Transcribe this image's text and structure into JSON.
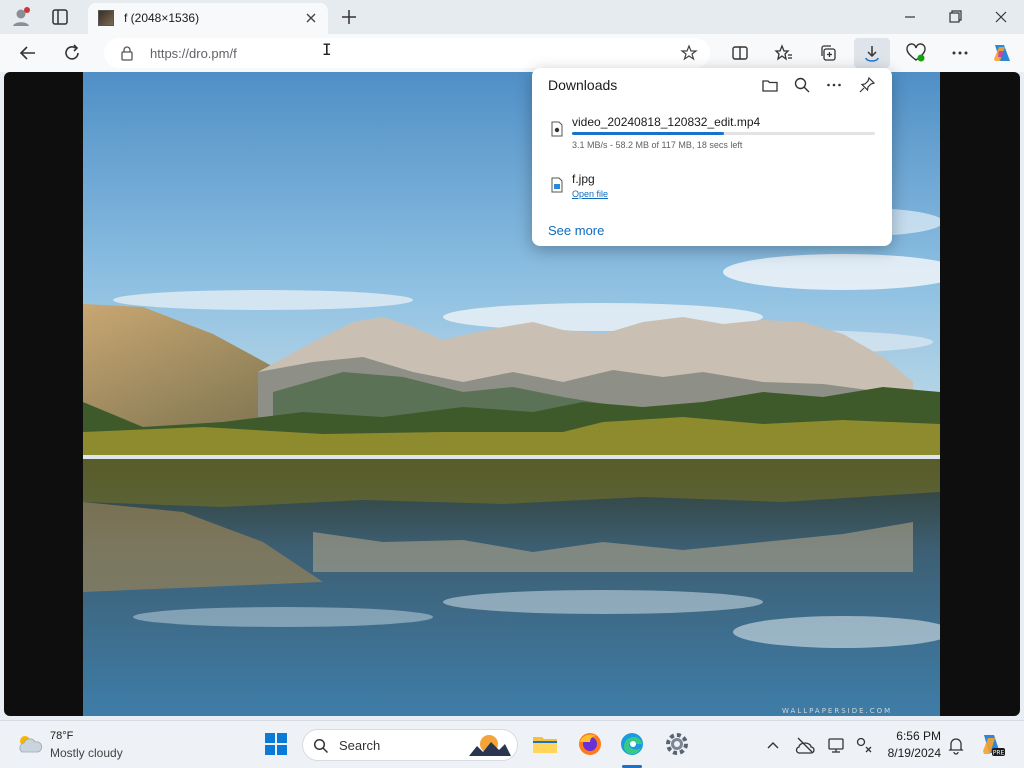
{
  "tab": {
    "title": "f (2048×1536)"
  },
  "address_bar": {
    "url": "https://dro.pm/f"
  },
  "downloads": {
    "title": "Downloads",
    "items": [
      {
        "name": "video_20240818_120832_edit.mp4",
        "status": "3.1 MB/s - 58.2 MB of 117 MB, 18 secs left",
        "progress": 0.5
      },
      {
        "name": "f.jpg",
        "action": "Open file"
      }
    ],
    "see_more": "See more"
  },
  "photo": {
    "watermark": "WALLPAPERSIDE.COM"
  },
  "taskbar": {
    "weather": {
      "temp": "78°F",
      "condition": "Mostly cloudy"
    },
    "search": {
      "label": "Search"
    },
    "clock": {
      "time": "6:56 PM",
      "date": "8/19/2024"
    }
  },
  "colors": {
    "accent": "#1a73c8",
    "link": "#0f6cbd"
  }
}
